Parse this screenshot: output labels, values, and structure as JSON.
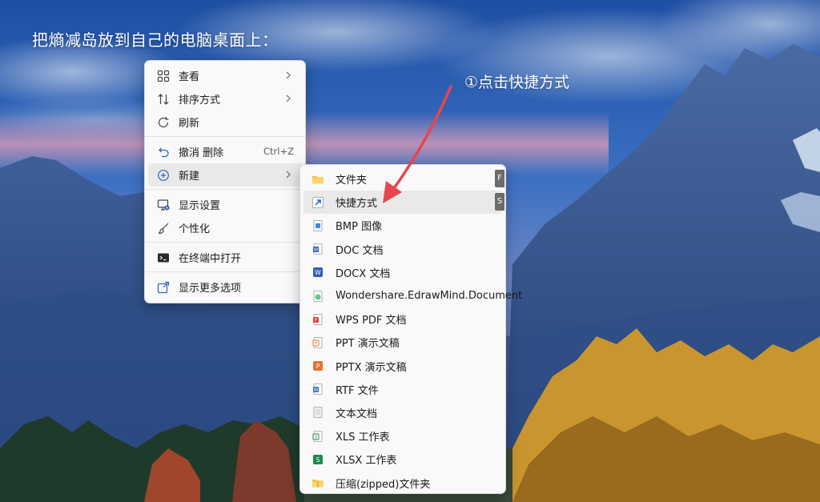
{
  "instruction": "把熵减岛放到自己的电脑桌面上：",
  "step_note": "①点击快捷方式",
  "context_menu": {
    "items": [
      {
        "label": "查看",
        "icon": "view-grid-icon",
        "has_submenu": true
      },
      {
        "label": "排序方式",
        "icon": "sort-icon",
        "has_submenu": true
      },
      {
        "label": "刷新",
        "icon": "refresh-icon"
      },
      {
        "label": "撤消 删除",
        "icon": "undo-icon",
        "accelerator": "Ctrl+Z"
      },
      {
        "label": "新建",
        "icon": "new-plus-icon",
        "has_submenu": true
      },
      {
        "label": "显示设置",
        "icon": "display-settings-icon"
      },
      {
        "label": "个性化",
        "icon": "personalize-brush-icon"
      },
      {
        "label": "在终端中打开",
        "icon": "terminal-icon"
      },
      {
        "label": "显示更多选项",
        "icon": "more-options-icon"
      }
    ]
  },
  "new_submenu": {
    "items": [
      {
        "label": "文件夹",
        "icon": "folder-icon",
        "key": "F"
      },
      {
        "label": "快捷方式",
        "icon": "shortcut-icon",
        "key": "S"
      },
      {
        "label": "BMP 图像",
        "icon": "bmp-image-icon"
      },
      {
        "label": "DOC 文档",
        "icon": "word-doc-icon"
      },
      {
        "label": "DOCX 文档",
        "icon": "word-docx-icon"
      },
      {
        "label": "Wondershare.EdrawMind.Document",
        "icon": "edrawmind-icon"
      },
      {
        "label": "WPS PDF 文档",
        "icon": "wps-pdf-icon"
      },
      {
        "label": "PPT 演示文稿",
        "icon": "ppt-icon"
      },
      {
        "label": "PPTX 演示文稿",
        "icon": "pptx-icon"
      },
      {
        "label": "RTF 文件",
        "icon": "rtf-icon"
      },
      {
        "label": "文本文档",
        "icon": "text-document-icon"
      },
      {
        "label": "XLS 工作表",
        "icon": "xls-icon"
      },
      {
        "label": "XLSX 工作表",
        "icon": "xlsx-icon"
      },
      {
        "label": "压缩(zipped)文件夹",
        "icon": "zip-folder-icon"
      }
    ]
  },
  "colors": {
    "annotation_arrow": "#e8454e",
    "menu_bg": "#f9f9f9",
    "highlight": "#e9e9e9",
    "accent_blue": "#2d63c8"
  }
}
